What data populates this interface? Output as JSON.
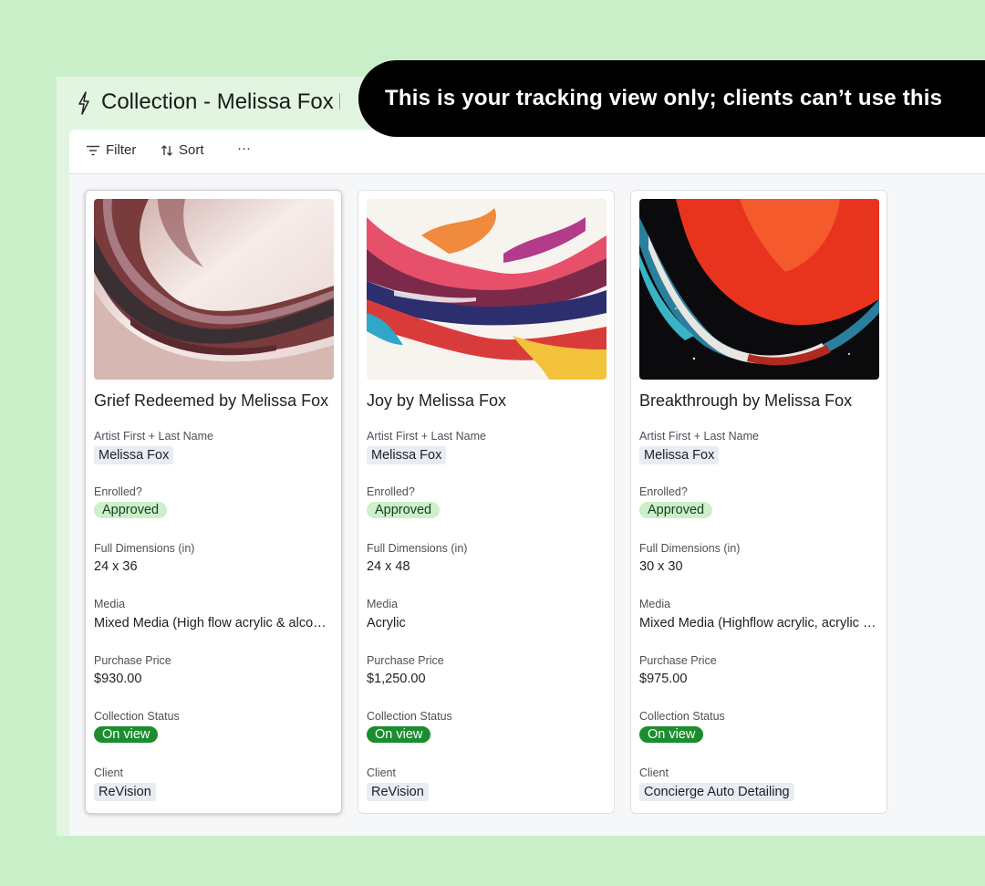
{
  "header": {
    "title": "Collection - Melissa Fox",
    "icon": "bolt-icon"
  },
  "banner": {
    "text": "This is your tracking view only; clients can’t use this"
  },
  "toolbar": {
    "filter_label": "Filter",
    "sort_label": "Sort",
    "more_label": "···"
  },
  "labels": {
    "artist": "Artist First + Last Name",
    "enrolled": "Enrolled?",
    "dimensions": "Full Dimensions (in)",
    "media": "Media",
    "price": "Purchase Price",
    "status": "Collection Status",
    "client": "Client"
  },
  "cards": [
    {
      "title": "Grief Redeemed by Melissa Fox",
      "artist": "Melissa Fox",
      "enrolled": "Approved",
      "dimensions": "24 x 36",
      "media": "Mixed Media (High flow acrylic & alcohol ink)",
      "price": "$930.00",
      "status": "On view",
      "client": "ReVision"
    },
    {
      "title": "Joy by Melissa Fox",
      "artist": "Melissa Fox",
      "enrolled": "Approved",
      "dimensions": "24 x 48",
      "media": "Acrylic",
      "price": "$1,250.00",
      "status": "On view",
      "client": "ReVision"
    },
    {
      "title": "Breakthrough by Melissa Fox",
      "artist": "Melissa Fox",
      "enrolled": "Approved",
      "dimensions": "30 x 30",
      "media": "Mixed Media (Highflow acrylic, acrylic pour)",
      "price": "$975.00",
      "status": "On view",
      "client": "Concierge Auto Detailing"
    }
  ],
  "colors": {
    "page_background": "#c9efc9",
    "banner_background": "#000000",
    "approved_pill": "#cdefc9",
    "on_view_pill": "#1b8d2f",
    "chip": "#e9edf3"
  }
}
